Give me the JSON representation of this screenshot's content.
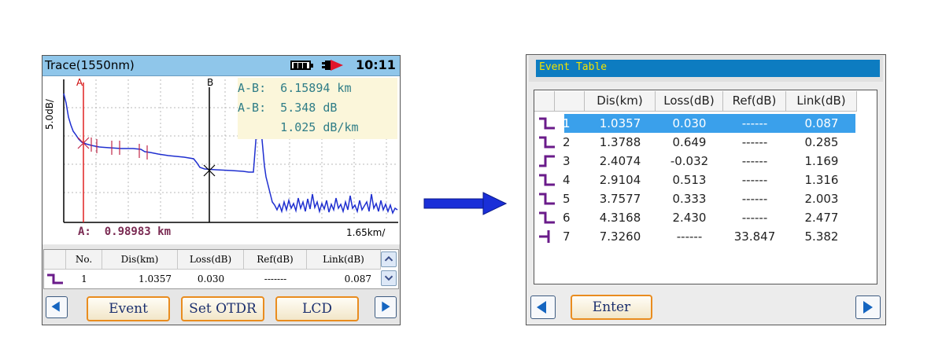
{
  "left_screen": {
    "title": "Trace(1550nm)",
    "status": {
      "time": "10:11",
      "battery_icon": "battery-icon",
      "power_icon": "plug-icon"
    },
    "trace": {
      "y_scale_label": "5.0dB/",
      "marker_a": "A",
      "marker_b": "B",
      "ab_distance": "A-B:  6.15894 km",
      "ab_loss": "A-B:  5.348 dB",
      "ab_atten": "      1.025 dB/km",
      "cursor_label": "A:  0.98983 km",
      "x_scale_label": "1.65km/"
    },
    "table": {
      "headers": [
        "No.",
        "Dis(km)",
        "Loss(dB)",
        "Ref(dB)",
        "Link(dB)"
      ],
      "row": {
        "no": "1",
        "dis": "1.0357",
        "loss": "0.030",
        "ref": "-------",
        "link": "0.087"
      }
    },
    "toolbar": {
      "left_arrow_icon": "left-arrow-icon",
      "event_label": "Event",
      "set_otdr_label": "Set OTDR",
      "lcd_label": "LCD",
      "right_arrow_icon": "right-arrow-icon"
    }
  },
  "arrow_icon": "right-arrow-icon",
  "right_screen": {
    "title": "Event Table",
    "headers": [
      "",
      "",
      "Dis(km)",
      "Loss(dB)",
      "Ref(dB)",
      "Link(dB)"
    ],
    "rows": [
      {
        "no": "1",
        "dis": "1.0357",
        "loss": "0.030",
        "ref": "------",
        "link": "0.087",
        "type": "loss-down",
        "selected": true
      },
      {
        "no": "2",
        "dis": "1.3788",
        "loss": "0.649",
        "ref": "------",
        "link": "0.285",
        "type": "loss-down"
      },
      {
        "no": "3",
        "dis": "2.4074",
        "loss": "-0.032",
        "ref": "------",
        "link": "1.169",
        "type": "gain-up"
      },
      {
        "no": "4",
        "dis": "2.9104",
        "loss": "0.513",
        "ref": "------",
        "link": "1.316",
        "type": "loss-down"
      },
      {
        "no": "5",
        "dis": "3.7577",
        "loss": "0.333",
        "ref": "------",
        "link": "2.003",
        "type": "loss-down"
      },
      {
        "no": "6",
        "dis": "4.3168",
        "loss": "2.430",
        "ref": "------",
        "link": "2.477",
        "type": "loss-down"
      },
      {
        "no": "7",
        "dis": "7.3260",
        "loss": "------",
        "ref": "33.847",
        "link": "5.382",
        "type": "end"
      }
    ],
    "toolbar": {
      "left_arrow_icon": "left-arrow-icon",
      "enter_label": "Enter",
      "right_arrow_icon": "right-arrow-icon"
    }
  },
  "colors": {
    "title_bar": "#8fc6ea",
    "event_title_bg": "#0d7cc1",
    "event_title_text": "#f2e300",
    "selection": "#3aa0eb",
    "trace": "#1f2fd0",
    "cursor_a": "#e02020",
    "event_icon": "#6a1b8a",
    "softkey_border": "#e98c1f",
    "arrow": "#1a2fd8"
  }
}
